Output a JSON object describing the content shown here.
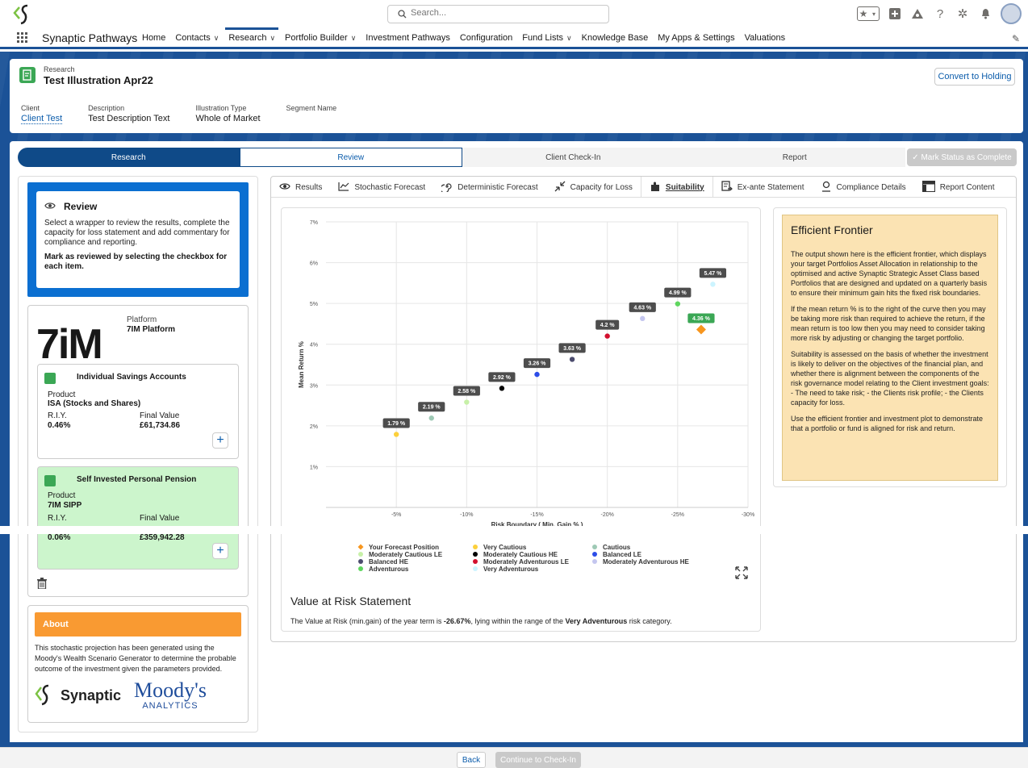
{
  "header": {
    "search_placeholder": "Search...",
    "app_name": "Synaptic Pathways",
    "nav": [
      {
        "label": "Home",
        "caret": false
      },
      {
        "label": "Contacts",
        "caret": true
      },
      {
        "label": "Research",
        "caret": true,
        "active": true
      },
      {
        "label": "Portfolio Builder",
        "caret": true
      },
      {
        "label": "Investment Pathways",
        "caret": false
      },
      {
        "label": "Configuration",
        "caret": false
      },
      {
        "label": "Fund Lists",
        "caret": true
      },
      {
        "label": "Knowledge Base",
        "caret": false
      },
      {
        "label": "My Apps & Settings",
        "caret": false
      },
      {
        "label": "Valuations",
        "caret": false
      }
    ]
  },
  "record": {
    "object": "Research",
    "title": "Test Illustration Apr22",
    "convert_label": "Convert to Holding",
    "fields": [
      {
        "label": "Client",
        "value": "Client Test",
        "link": true
      },
      {
        "label": "Description",
        "value": "Test Description Text",
        "link": false
      },
      {
        "label": "Illustration Type",
        "value": "Whole of Market",
        "link": false
      },
      {
        "label": "Segment Name",
        "value": "",
        "link": false
      }
    ]
  },
  "path": {
    "steps": [
      {
        "label": "Research",
        "state": "complete"
      },
      {
        "label": "Review",
        "state": "current"
      },
      {
        "label": "Client Check-In",
        "state": "todo"
      },
      {
        "label": "Report",
        "state": "todo"
      }
    ],
    "mark_label": "✓ Mark Status as Complete"
  },
  "review": {
    "title": "Review",
    "text": "Select a wrapper to review the results, complete the capacity for loss statement and add commentary for compliance and reporting.",
    "bold": "Mark as reviewed by selecting the checkbox for each item."
  },
  "platform": {
    "logo_text": "7iM",
    "label": "Platform",
    "name": "7IM Platform",
    "wrappers": [
      {
        "title": "Individual Savings Accounts",
        "product_label": "Product",
        "product": "ISA (Stocks and Shares)",
        "riy_label": "R.I.Y.",
        "riy": "0.46%",
        "fv_label": "Final Value",
        "fv": "£61,734.86"
      },
      {
        "title": "Self Invested Personal Pension",
        "product_label": "Product",
        "product": "7IM SIPP",
        "riy_label": "R.I.Y.",
        "riy": "0.06%",
        "fv_label": "Final Value",
        "fv": "£359,942.28"
      }
    ]
  },
  "about": {
    "title": "About",
    "text": "This stochastic projection has been generated using the Moody's Wealth Scenario Generator to determine the probable outcome of the investment given the parameters provided.",
    "synaptic": "Synaptic",
    "moodys": "Moody's",
    "analytics": "ANALYTICS"
  },
  "tabs": [
    {
      "label": "Results",
      "icon": "eye-icon"
    },
    {
      "label": "Stochastic Forecast",
      "icon": "line-chart-icon"
    },
    {
      "label": "Deterministic Forecast",
      "icon": "spiral-icon"
    },
    {
      "label": "Capacity for Loss",
      "icon": "shrink-icon"
    },
    {
      "label": "Suitability",
      "icon": "puzzle-icon",
      "active": true
    },
    {
      "label": "Ex-ante Statement",
      "icon": "document-arrow-icon"
    },
    {
      "label": "Compliance Details",
      "icon": "magnifier-user-icon"
    },
    {
      "label": "Report Content",
      "icon": "table-icon"
    }
  ],
  "chart_data": {
    "type": "scatter",
    "xlabel": "Risk Boundary ( Min. Gain % )",
    "ylabel": "Mean Return %",
    "x_ticks": [
      "-5%",
      "-10%",
      "-15%",
      "-20%",
      "-25%",
      "-30%"
    ],
    "x_tick_values": [
      -5,
      -10,
      -15,
      -20,
      -25,
      -30
    ],
    "y_ticks": [
      "1%",
      "2%",
      "3%",
      "4%",
      "5%",
      "6%",
      "7%"
    ],
    "y_tick_values": [
      1,
      2,
      3,
      4,
      5,
      6,
      7
    ],
    "xlim": [
      0,
      -30
    ],
    "ylim": [
      0,
      7
    ],
    "grid": true,
    "points": [
      {
        "name": "Very Cautious",
        "x": -5,
        "y": 1.79,
        "label": "1.79 %",
        "color": "#fcd03b"
      },
      {
        "name": "Cautious",
        "x": -7.5,
        "y": 2.19,
        "label": "2.19 %",
        "color": "#9ec9b5"
      },
      {
        "name": "Moderately Cautious LE",
        "x": -10,
        "y": 2.58,
        "label": "2.58 %",
        "color": "#c7f0a8"
      },
      {
        "name": "Moderately Cautious HE",
        "x": -12.5,
        "y": 2.92,
        "label": "2.92 %",
        "color": "#000000"
      },
      {
        "name": "Balanced LE",
        "x": -15,
        "y": 3.26,
        "label": "3.26 %",
        "color": "#2c4de8"
      },
      {
        "name": "Balanced HE",
        "x": -17.5,
        "y": 3.63,
        "label": "3.63 %",
        "color": "#4c4c6e"
      },
      {
        "name": "Moderately Adventurous LE",
        "x": -20,
        "y": 4.2,
        "label": "4.2 %",
        "color": "#d3102e"
      },
      {
        "name": "Moderately Adventurous HE",
        "x": -22.5,
        "y": 4.63,
        "label": "4.63 %",
        "color": "#c4c6ef"
      },
      {
        "name": "Adventurous",
        "x": -25,
        "y": 4.99,
        "label": "4.99 %",
        "color": "#5fd65f"
      },
      {
        "name": "Very Adventurous",
        "x": -27.5,
        "y": 5.47,
        "label": "5.47 %",
        "color": "#ccf4ff"
      },
      {
        "name": "Your Forecast Position",
        "x": -26.67,
        "y": 4.36,
        "label": "4.36 %",
        "color": "#f7961e",
        "marker": "diamond",
        "label_color": "#3ba755"
      }
    ],
    "legend": [
      [
        {
          "name": "Your Forecast Position",
          "color": "#f7961e",
          "marker": "diamond"
        },
        {
          "name": "Moderately Cautious LE",
          "color": "#c7f0a8"
        },
        {
          "name": "Balanced HE",
          "color": "#4c4c6e"
        },
        {
          "name": "Adventurous",
          "color": "#5fd65f"
        }
      ],
      [
        {
          "name": "Very Cautious",
          "color": "#fcd03b"
        },
        {
          "name": "Moderately Cautious HE",
          "color": "#000000"
        },
        {
          "name": "Moderately Adventurous LE",
          "color": "#d3102e"
        },
        {
          "name": "Very Adventurous",
          "color": "#ccf4ff"
        }
      ],
      [
        {
          "name": "Cautious",
          "color": "#9ec9b5"
        },
        {
          "name": "Balanced LE",
          "color": "#2c4de8"
        },
        {
          "name": "Moderately Adventurous HE",
          "color": "#c4c6ef"
        }
      ]
    ],
    "legend_position": "bottom"
  },
  "var": {
    "title": "Value at Risk Statement",
    "text_pre": "The Value at Risk (min.gain) of the year term is ",
    "value": "-26.67%",
    "text_mid": ", lying within the range of the ",
    "category": "Very Adventurous",
    "text_post": " risk category."
  },
  "efficient_frontier": {
    "title": "Efficient Frontier",
    "paragraphs": [
      "The output shown here is the efficient frontier, which displays your target Portfolios Asset Allocation in relationship to the optimised and active Synaptic Strategic Asset Class based Portfolios that are designed and updated on a quarterly basis to ensure their minimum gain hits the fixed risk boundaries.",
      "If the mean return % is to the right of the curve then you may be taking more risk than required to achieve the return, if the mean return is too low then you may need to consider taking more risk by adjusting or changing the target portfolio.",
      "Suitability is assessed on the basis of whether the investment is likely to deliver on the objectives of the financial plan, and whether there is alignment between the components of the risk governance model relating to the Client investment goals: - The need to take risk; - the Clients risk profile; - the Clients capacity for loss.",
      "Use the efficient frontier and investment plot to demonstrate that a portfolio or fund is aligned for risk and return."
    ]
  },
  "footer": {
    "back_label": "Back",
    "continue_label": "Continue to Check-In"
  },
  "colors": {
    "brand_blue": "#1b5297",
    "path_complete": "#0f4a88",
    "about_orange": "#f99a32",
    "ef_background": "#fbe3b3"
  }
}
